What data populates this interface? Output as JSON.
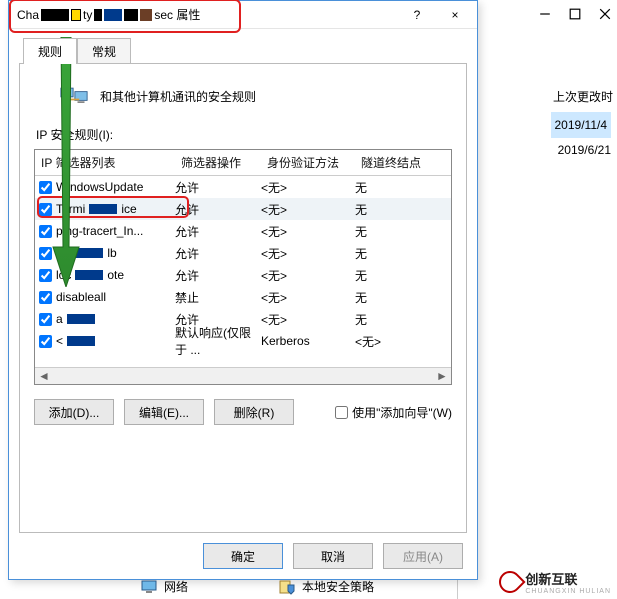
{
  "bgwin": {
    "column_header": "上次更改时",
    "dates": [
      "2019/11/4",
      "2019/6/21"
    ]
  },
  "titlebar": {
    "prefix": "Cha",
    "mid": "ty",
    "suffix": "sec 属性",
    "help": "?",
    "close": "×"
  },
  "tabs": {
    "rules": "规则",
    "general": "常规"
  },
  "iconrow_label": "和其他计算机通讯的安全规则",
  "section_label": "IP 安全规则(I):",
  "columns": {
    "c1": "IP 筛选器列表",
    "c2": "筛选器操作",
    "c3": "身份验证方法",
    "c4": "隧道终结点"
  },
  "rows": [
    {
      "checked": true,
      "name": "WindowsUpdate",
      "ob": false,
      "action": "允许",
      "auth": "<无>",
      "tunnel": "无",
      "sel": false
    },
    {
      "checked": true,
      "name": "Termi",
      "name2": "ice",
      "ob": true,
      "action": "允许",
      "auth": "<无>",
      "tunnel": "无",
      "sel": true
    },
    {
      "checked": true,
      "name": "ping-tracert_In...",
      "ob": false,
      "action": "允许",
      "auth": "<无>",
      "tunnel": "无",
      "sel": false
    },
    {
      "checked": true,
      "name": "loc",
      "name2": "lb",
      "ob": true,
      "action": "允许",
      "auth": "<无>",
      "tunnel": "无",
      "sel": false
    },
    {
      "checked": true,
      "name": "loc",
      "name2": "ote",
      "ob": true,
      "action": "允许",
      "auth": "<无>",
      "tunnel": "无",
      "sel": false
    },
    {
      "checked": true,
      "name": "disableall",
      "ob": false,
      "action": "禁止",
      "auth": "<无>",
      "tunnel": "无",
      "sel": false
    },
    {
      "checked": true,
      "name": "a",
      "name2": "",
      "ob": true,
      "action": "允许",
      "auth": "<无>",
      "tunnel": "无",
      "sel": false
    },
    {
      "checked": true,
      "name": "<",
      "name2": "",
      "ob": true,
      "action": "默认响应(仅限于 ...",
      "auth": "Kerberos",
      "tunnel": "<无>",
      "sel": false
    }
  ],
  "buttons": {
    "add": "添加(D)...",
    "edit": "编辑(E)...",
    "remove": "删除(R)",
    "wizard": "使用\"添加向导\"(W)"
  },
  "footer": {
    "ok": "确定",
    "cancel": "取消",
    "apply": "应用(A)"
  },
  "bottomstrip": {
    "network": "网络",
    "policy": "本地安全策略"
  },
  "logo": {
    "text": "创新互联",
    "sub": "CHUANGXIN HULIAN"
  }
}
